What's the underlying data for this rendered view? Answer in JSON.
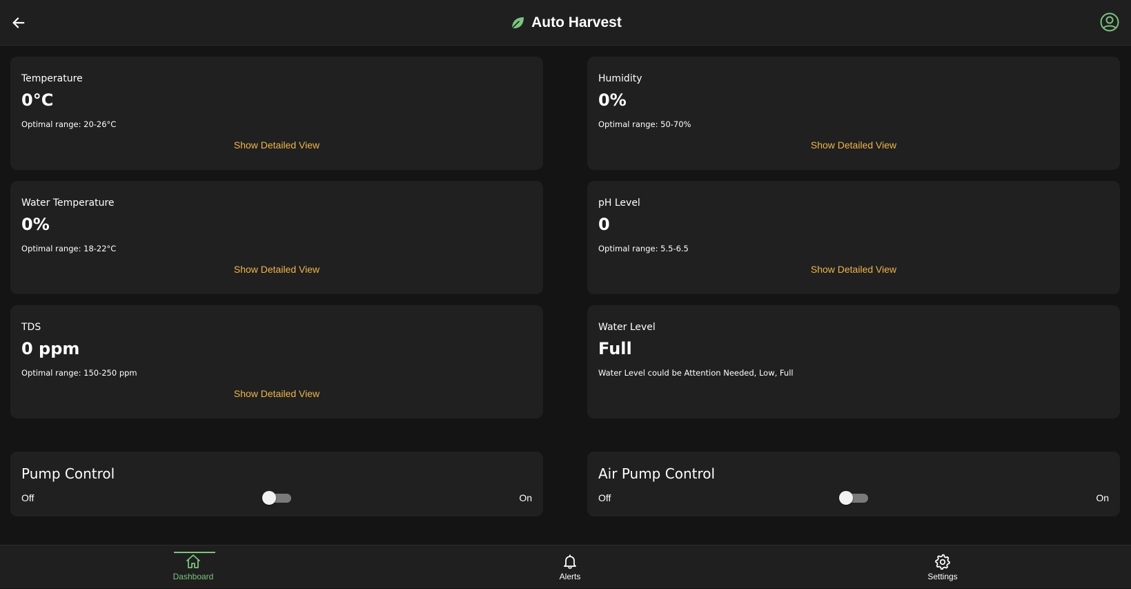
{
  "header": {
    "title": "Auto Harvest",
    "accent_color": "#7cc47f"
  },
  "metrics": [
    {
      "label": "Temperature",
      "value": "0°C",
      "note": "Optimal range: 20-26°C",
      "link": "Show Detailed View"
    },
    {
      "label": "Humidity",
      "value": "0%",
      "note": "Optimal range: 50-70%",
      "link": "Show Detailed View"
    },
    {
      "label": "Water Temperature",
      "value": "0%",
      "note": "Optimal range: 18-22°C",
      "link": "Show Detailed View"
    },
    {
      "label": "pH Level",
      "value": "0",
      "note": "Optimal range: 5.5-6.5",
      "link": "Show Detailed View"
    },
    {
      "label": "TDS",
      "value": "0 ppm",
      "note": "Optimal range: 150-250 ppm",
      "link": "Show Detailed View"
    },
    {
      "label": "Water Level",
      "value": "Full",
      "note": "Water Level could be Attention Needed, Low, Full"
    }
  ],
  "controls": [
    {
      "title": "Pump Control",
      "off_label": "Off",
      "on_label": "On",
      "state": "off"
    },
    {
      "title": "Air Pump Control",
      "off_label": "Off",
      "on_label": "On",
      "state": "off"
    }
  ],
  "nav": {
    "items": [
      {
        "label": "Dashboard",
        "icon": "home-icon",
        "active": true
      },
      {
        "label": "Alerts",
        "icon": "bell-icon",
        "active": false
      },
      {
        "label": "Settings",
        "icon": "gear-icon",
        "active": false
      }
    ]
  },
  "colors": {
    "link": "#f0b54b",
    "background": "#141414",
    "card": "#202020"
  }
}
